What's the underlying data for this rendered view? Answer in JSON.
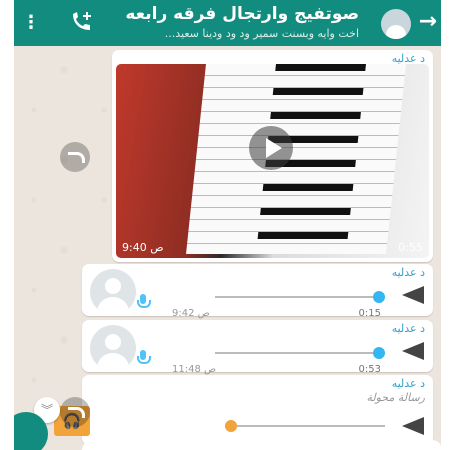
{
  "header": {
    "title": "صوتفيج وارتجال فرقه رابعه",
    "subtitle": "اخت وايه وبسنت سمير ود ود ودينا سعيد..."
  },
  "messages": [
    {
      "type": "video",
      "sender": "د عدليه",
      "duration": "0:55",
      "time": "9:40 ص"
    },
    {
      "type": "voice",
      "sender": "د عدليه",
      "duration": "0:15",
      "time": "9:42 ص"
    },
    {
      "type": "voice",
      "sender": "د عدليه",
      "duration": "0:53",
      "time": "11:48 ص"
    },
    {
      "type": "audio",
      "sender": "د عدليه",
      "forwarded_label": "رسالة محولة"
    }
  ],
  "colors": {
    "header": "#128c7e",
    "accent": "#34b7f1",
    "audio": "#f2a33a"
  }
}
